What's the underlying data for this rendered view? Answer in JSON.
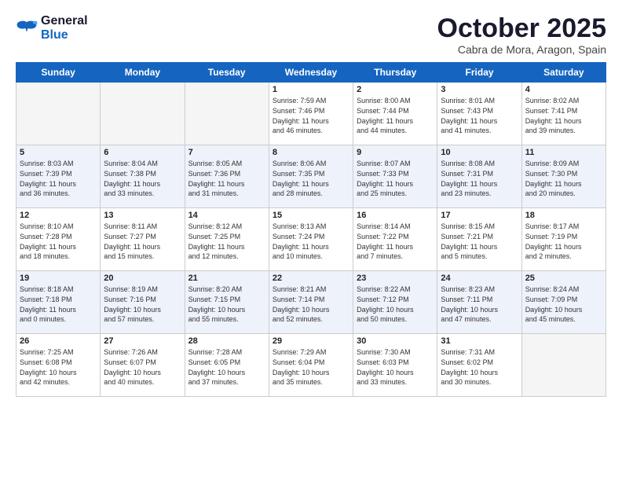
{
  "logo": {
    "line1": "General",
    "line2": "Blue"
  },
  "title": "October 2025",
  "subtitle": "Cabra de Mora, Aragon, Spain",
  "days_of_week": [
    "Sunday",
    "Monday",
    "Tuesday",
    "Wednesday",
    "Thursday",
    "Friday",
    "Saturday"
  ],
  "weeks": [
    [
      {
        "num": "",
        "info": ""
      },
      {
        "num": "",
        "info": ""
      },
      {
        "num": "",
        "info": ""
      },
      {
        "num": "1",
        "info": "Sunrise: 7:59 AM\nSunset: 7:46 PM\nDaylight: 11 hours\nand 46 minutes."
      },
      {
        "num": "2",
        "info": "Sunrise: 8:00 AM\nSunset: 7:44 PM\nDaylight: 11 hours\nand 44 minutes."
      },
      {
        "num": "3",
        "info": "Sunrise: 8:01 AM\nSunset: 7:43 PM\nDaylight: 11 hours\nand 41 minutes."
      },
      {
        "num": "4",
        "info": "Sunrise: 8:02 AM\nSunset: 7:41 PM\nDaylight: 11 hours\nand 39 minutes."
      }
    ],
    [
      {
        "num": "5",
        "info": "Sunrise: 8:03 AM\nSunset: 7:39 PM\nDaylight: 11 hours\nand 36 minutes."
      },
      {
        "num": "6",
        "info": "Sunrise: 8:04 AM\nSunset: 7:38 PM\nDaylight: 11 hours\nand 33 minutes."
      },
      {
        "num": "7",
        "info": "Sunrise: 8:05 AM\nSunset: 7:36 PM\nDaylight: 11 hours\nand 31 minutes."
      },
      {
        "num": "8",
        "info": "Sunrise: 8:06 AM\nSunset: 7:35 PM\nDaylight: 11 hours\nand 28 minutes."
      },
      {
        "num": "9",
        "info": "Sunrise: 8:07 AM\nSunset: 7:33 PM\nDaylight: 11 hours\nand 25 minutes."
      },
      {
        "num": "10",
        "info": "Sunrise: 8:08 AM\nSunset: 7:31 PM\nDaylight: 11 hours\nand 23 minutes."
      },
      {
        "num": "11",
        "info": "Sunrise: 8:09 AM\nSunset: 7:30 PM\nDaylight: 11 hours\nand 20 minutes."
      }
    ],
    [
      {
        "num": "12",
        "info": "Sunrise: 8:10 AM\nSunset: 7:28 PM\nDaylight: 11 hours\nand 18 minutes."
      },
      {
        "num": "13",
        "info": "Sunrise: 8:11 AM\nSunset: 7:27 PM\nDaylight: 11 hours\nand 15 minutes."
      },
      {
        "num": "14",
        "info": "Sunrise: 8:12 AM\nSunset: 7:25 PM\nDaylight: 11 hours\nand 12 minutes."
      },
      {
        "num": "15",
        "info": "Sunrise: 8:13 AM\nSunset: 7:24 PM\nDaylight: 11 hours\nand 10 minutes."
      },
      {
        "num": "16",
        "info": "Sunrise: 8:14 AM\nSunset: 7:22 PM\nDaylight: 11 hours\nand 7 minutes."
      },
      {
        "num": "17",
        "info": "Sunrise: 8:15 AM\nSunset: 7:21 PM\nDaylight: 11 hours\nand 5 minutes."
      },
      {
        "num": "18",
        "info": "Sunrise: 8:17 AM\nSunset: 7:19 PM\nDaylight: 11 hours\nand 2 minutes."
      }
    ],
    [
      {
        "num": "19",
        "info": "Sunrise: 8:18 AM\nSunset: 7:18 PM\nDaylight: 11 hours\nand 0 minutes."
      },
      {
        "num": "20",
        "info": "Sunrise: 8:19 AM\nSunset: 7:16 PM\nDaylight: 10 hours\nand 57 minutes."
      },
      {
        "num": "21",
        "info": "Sunrise: 8:20 AM\nSunset: 7:15 PM\nDaylight: 10 hours\nand 55 minutes."
      },
      {
        "num": "22",
        "info": "Sunrise: 8:21 AM\nSunset: 7:14 PM\nDaylight: 10 hours\nand 52 minutes."
      },
      {
        "num": "23",
        "info": "Sunrise: 8:22 AM\nSunset: 7:12 PM\nDaylight: 10 hours\nand 50 minutes."
      },
      {
        "num": "24",
        "info": "Sunrise: 8:23 AM\nSunset: 7:11 PM\nDaylight: 10 hours\nand 47 minutes."
      },
      {
        "num": "25",
        "info": "Sunrise: 8:24 AM\nSunset: 7:09 PM\nDaylight: 10 hours\nand 45 minutes."
      }
    ],
    [
      {
        "num": "26",
        "info": "Sunrise: 7:25 AM\nSunset: 6:08 PM\nDaylight: 10 hours\nand 42 minutes."
      },
      {
        "num": "27",
        "info": "Sunrise: 7:26 AM\nSunset: 6:07 PM\nDaylight: 10 hours\nand 40 minutes."
      },
      {
        "num": "28",
        "info": "Sunrise: 7:28 AM\nSunset: 6:05 PM\nDaylight: 10 hours\nand 37 minutes."
      },
      {
        "num": "29",
        "info": "Sunrise: 7:29 AM\nSunset: 6:04 PM\nDaylight: 10 hours\nand 35 minutes."
      },
      {
        "num": "30",
        "info": "Sunrise: 7:30 AM\nSunset: 6:03 PM\nDaylight: 10 hours\nand 33 minutes."
      },
      {
        "num": "31",
        "info": "Sunrise: 7:31 AM\nSunset: 6:02 PM\nDaylight: 10 hours\nand 30 minutes."
      },
      {
        "num": "",
        "info": ""
      }
    ]
  ]
}
